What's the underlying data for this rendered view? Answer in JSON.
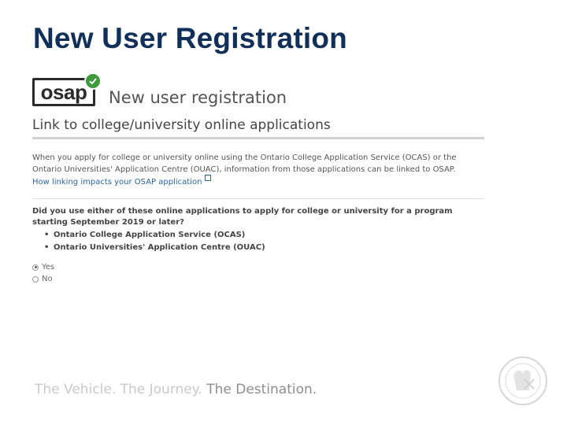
{
  "slide": {
    "title": "New User Registration"
  },
  "logo": {
    "text": "osap"
  },
  "form": {
    "heading": "New user registration",
    "section_title": "Link to college/university online applications",
    "info_text": "When you apply for college or university online using the Ontario College Application Service (OCAS) or the Ontario Universities' Application Centre (OUAC), information from those applications can be linked to OSAP.",
    "link_text": "How linking impacts your OSAP application",
    "question": "Did you use either of these online applications to apply for college or university for a program starting September 2019 or later?",
    "bullets": [
      "Ontario College Application Service (OCAS)",
      "Ontario Universities' Application Centre (OUAC)"
    ],
    "options": [
      {
        "label": "Yes",
        "selected": true
      },
      {
        "label": "No",
        "selected": false
      }
    ]
  },
  "footer": {
    "tagline_part1": "The Vehicle. The Journey.",
    "tagline_part2": "The Destination."
  },
  "colors": {
    "title": "#10305a",
    "link": "#2a64a8",
    "check": "#3e9a3c"
  }
}
